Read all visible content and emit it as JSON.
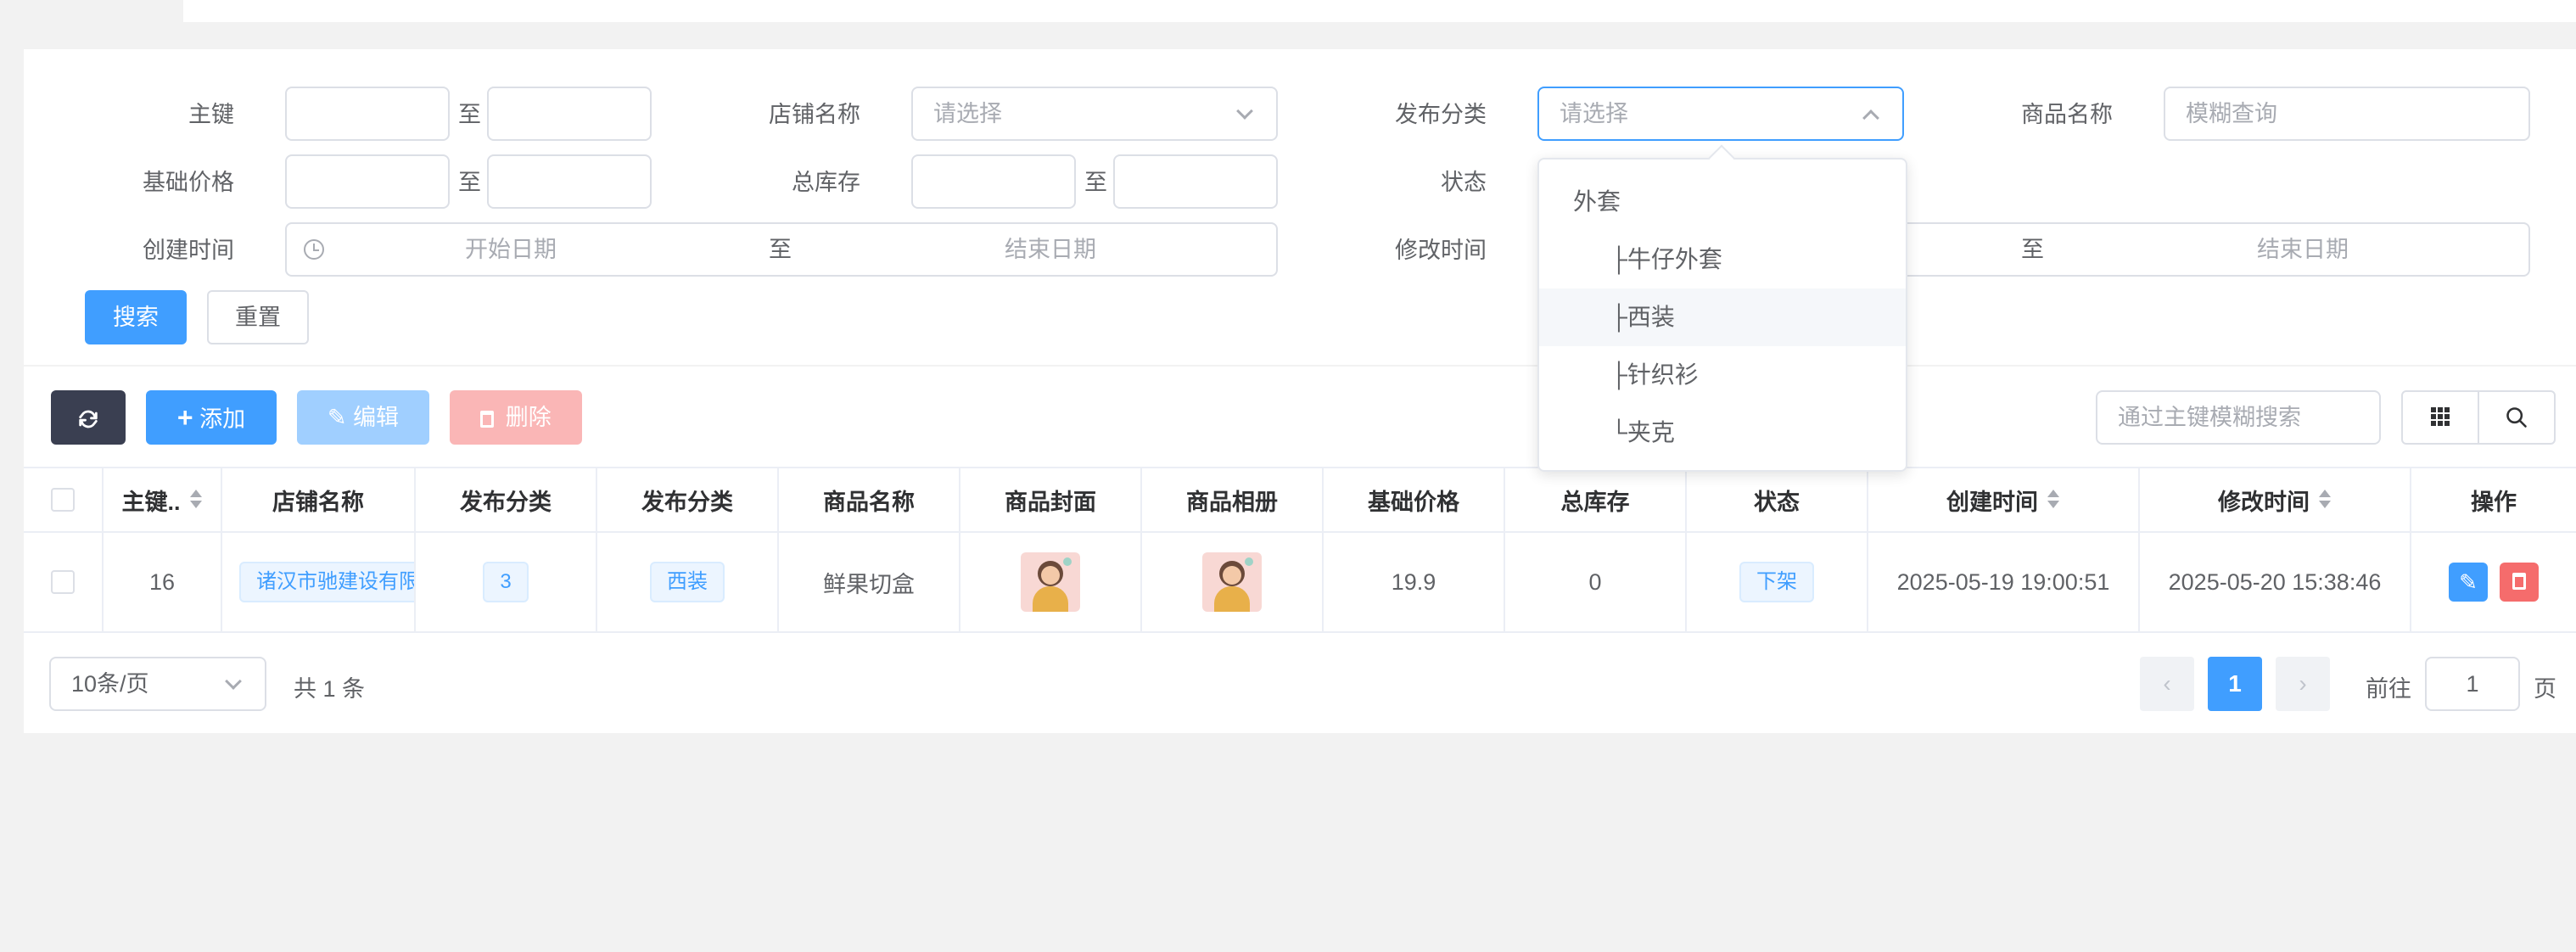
{
  "search": {
    "pk_label": "主键",
    "to": "至",
    "shop_label": "店铺名称",
    "shop_placeholder": "请选择",
    "category_label": "发布分类",
    "category_placeholder": "请选择",
    "product_label": "商品名称",
    "product_placeholder": "模糊查询",
    "price_label": "基础价格",
    "stock_label": "总库存",
    "status_label": "状态",
    "created_label": "创建时间",
    "start_placeholder": "开始日期",
    "end_placeholder": "结束日期",
    "modified_label": "修改时间",
    "search_btn": "搜索",
    "reset_btn": "重置"
  },
  "category_dropdown": {
    "items": [
      "外套",
      "├牛仔外套",
      "├西装",
      "├针织衫",
      "└夹克"
    ],
    "hovered_index": 2
  },
  "toolbar": {
    "add": "添加",
    "edit": "编辑",
    "delete": "删除",
    "pk_search_placeholder": "通过主键模糊搜索"
  },
  "table": {
    "headers": [
      "主键..",
      "店铺名称",
      "发布分类",
      "发布分类",
      "商品名称",
      "商品封面",
      "商品相册",
      "基础价格",
      "总库存",
      "状态",
      "创建时间",
      "修改时间",
      "操作"
    ],
    "rows": [
      {
        "id": "16",
        "shop": "诸汉市驰建设有限",
        "category_id": "3",
        "category": "西装",
        "name": "鲜果切盒",
        "price": "19.9",
        "stock": "0",
        "status": "下架",
        "created": "2025-05-19 19:00:51",
        "modified": "2025-05-20 15:38:46"
      }
    ]
  },
  "pagination": {
    "page_size": "10条/页",
    "total": "共 1 条",
    "current": "1",
    "goto_label": "前往",
    "goto_value": "1",
    "page_unit": "页"
  },
  "colors": {
    "primary": "#409eff",
    "danger": "#f56c6c",
    "dark": "#3a3f51"
  }
}
